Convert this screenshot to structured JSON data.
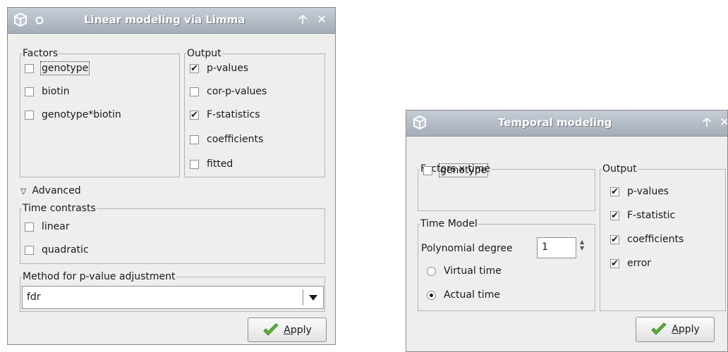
{
  "colors": {
    "titlebar": "#a4adb8",
    "window_bg": "#eeeeec",
    "check_green": "#5db33a"
  },
  "win1": {
    "title": "Linear modeling via Limma",
    "factors": {
      "legend": "Factors",
      "items": [
        {
          "label": "genotype",
          "checked": false
        },
        {
          "label": "biotin",
          "checked": false
        },
        {
          "label": "genotype*biotin",
          "checked": false
        }
      ]
    },
    "output": {
      "legend": "Output",
      "items": [
        {
          "label": "p-values",
          "checked": true
        },
        {
          "label": "cor-p-values",
          "checked": false
        },
        {
          "label": "F-statistics",
          "checked": true
        },
        {
          "label": "coefficients",
          "checked": false
        },
        {
          "label": "fitted",
          "checked": false
        }
      ]
    },
    "advanced_label": "Advanced",
    "time_contrasts": {
      "legend": "Time contrasts",
      "items": [
        {
          "label": "linear",
          "checked": false
        },
        {
          "label": "quadratic",
          "checked": false
        }
      ]
    },
    "method": {
      "legend": "Method for p-value adjustment",
      "value": "fdr"
    },
    "apply": {
      "mnemonic": "A",
      "rest": "pply"
    }
  },
  "win2": {
    "title": "Temporal modeling",
    "factors_time": {
      "legend": "Factors x time",
      "items": [
        {
          "label": "genotype",
          "checked": false
        }
      ]
    },
    "time_model": {
      "legend": "Time Model",
      "degree_label": "Polynomial degree",
      "degree_value": "1",
      "radios": [
        {
          "label": "Virtual time",
          "selected": false
        },
        {
          "label": "Actual time",
          "selected": true
        }
      ]
    },
    "output": {
      "legend": "Output",
      "items": [
        {
          "label": "p-values",
          "checked": true
        },
        {
          "label": "F-statistic",
          "checked": true
        },
        {
          "label": "coefficients",
          "checked": true
        },
        {
          "label": "error",
          "checked": true
        }
      ]
    },
    "apply": {
      "mnemonic": "A",
      "rest": "pply"
    }
  }
}
